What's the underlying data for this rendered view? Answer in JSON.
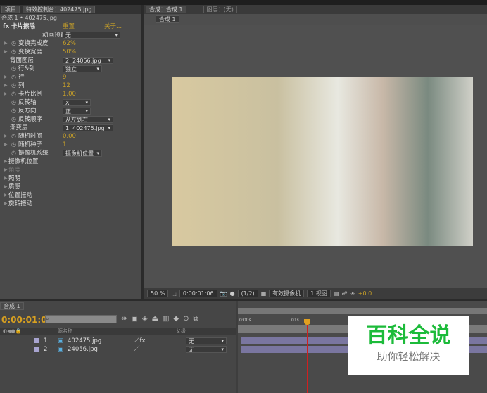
{
  "left_panel": {
    "tabs": [
      "项目",
      "特效控制台：402475.jpg"
    ],
    "subtitle": "合成 1 • 402475.jpg",
    "effect": {
      "name": "卡片擦除",
      "reset": "重置",
      "about": "关于..."
    },
    "params": [
      {
        "label": "动画预置",
        "value": "无",
        "type": "dd"
      },
      {
        "label": "变换完成度",
        "value": "62%",
        "type": "val"
      },
      {
        "label": "变换宽度",
        "value": "50%",
        "type": "val"
      },
      {
        "label": "背面图层",
        "value": "2. 24056.jpg",
        "type": "dd"
      },
      {
        "label": "行&列",
        "value": "独立",
        "type": "dd"
      },
      {
        "label": "行",
        "value": "9",
        "type": "val"
      },
      {
        "label": "列",
        "value": "12",
        "type": "val"
      },
      {
        "label": "卡片比例",
        "value": "1.00",
        "type": "val"
      },
      {
        "label": "反转轴",
        "value": "X",
        "type": "dd"
      },
      {
        "label": "反方向",
        "value": "正",
        "type": "dd"
      },
      {
        "label": "反转顺序",
        "value": "从左到右",
        "type": "dd"
      },
      {
        "label": "渐变层",
        "value": "1. 402475.jpg",
        "type": "dd"
      },
      {
        "label": "随机时间",
        "value": "0.00",
        "type": "val"
      },
      {
        "label": "随机种子",
        "value": "1",
        "type": "val"
      },
      {
        "label": "摄像机系统",
        "value": "摄像机位置",
        "type": "dd"
      },
      {
        "label": "摄像机位置",
        "type": "group"
      },
      {
        "label": "角度",
        "type": "group"
      },
      {
        "label": "照明",
        "type": "group"
      },
      {
        "label": "质感",
        "type": "group"
      },
      {
        "label": "位置振动",
        "type": "group"
      },
      {
        "label": "旋转振动",
        "type": "group"
      }
    ]
  },
  "comp_panel": {
    "tabs": [
      "合成：合成 1",
      "图层：(无)"
    ],
    "comp_button": "合成 1",
    "toolbar": {
      "zoom": "50 %",
      "timecode": "0:00:01:06",
      "resolution": "(1/2)",
      "camera": "有效摄像机",
      "views": "1 视图",
      "exposure": "+0.0"
    }
  },
  "timeline": {
    "tab": "合成 1",
    "timecode": "0:00:01:06",
    "search_placeholder": "",
    "col_source": "源名称",
    "col_parent": "父级",
    "layers": [
      {
        "num": "1",
        "name": "402475.jpg",
        "parent": "无"
      },
      {
        "num": "2",
        "name": "24056.jpg",
        "parent": "无"
      }
    ],
    "ruler": [
      "0:00s",
      "01s"
    ]
  },
  "watermark": {
    "title": "百科全说",
    "subtitle": "助你轻松解决"
  }
}
